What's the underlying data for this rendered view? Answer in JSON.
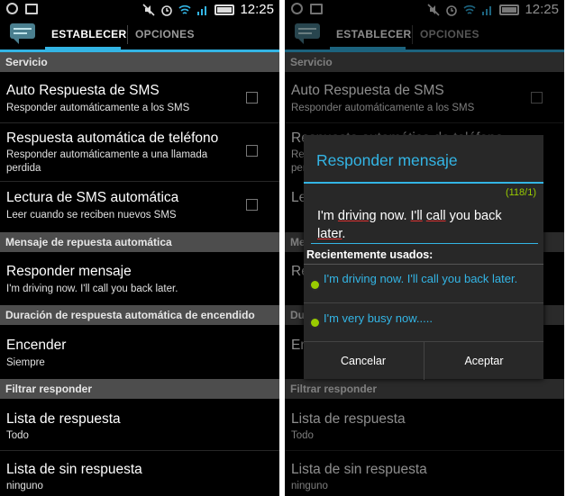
{
  "status": {
    "time": "12:25"
  },
  "tabs": {
    "active": "ESTABLECER",
    "inactive": "OPCIONES"
  },
  "sections": {
    "servicio": "Servicio",
    "mensaje": "Mensaje de repuesta automática",
    "duracion": "Duración de respuesta automática de encendido",
    "filtrar": "Filtrar responder"
  },
  "items": {
    "auto_sms": {
      "title": "Auto Respuesta de SMS",
      "summary": "Responder automáticamente a los SMS"
    },
    "auto_tel": {
      "title": "Respuesta automática de teléfono",
      "summary": "Responder automáticamente a una llamada perdida"
    },
    "lectura": {
      "title": "Lectura de SMS automática",
      "summary": "Leer cuando se reciben nuevos SMS"
    },
    "responder": {
      "title": "Responder mensaje",
      "summary": "I'm driving now. I'll call you back later."
    },
    "encender": {
      "title": "Encender",
      "summary": "Siempre"
    },
    "lista_resp": {
      "title": "Lista de respuesta",
      "summary": "Todo"
    },
    "lista_sin": {
      "title": "Lista de sin respuesta",
      "summary": "ninguno"
    }
  },
  "dialog": {
    "title": "Responder mensaje",
    "counter": "(118/1)",
    "text_parts": [
      "I'm ",
      "driving",
      " now. ",
      "I'll",
      " ",
      "call",
      " you back ",
      "later",
      "."
    ],
    "recent_header": "Recientemente usados:",
    "recent": [
      "I'm driving now. I'll call you back later.",
      "I'm very busy now....."
    ],
    "cancel": "Cancelar",
    "accept": "Aceptar"
  },
  "colors": {
    "accent": "#33b5e5",
    "green": "#99cc00"
  }
}
